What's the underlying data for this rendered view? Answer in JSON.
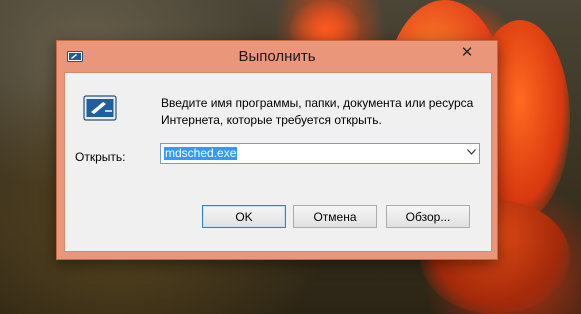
{
  "window": {
    "title": "Выполнить",
    "close_symbol": "✕"
  },
  "content": {
    "description": "Введите имя программы, папки, документа или ресурса Интернета, которые требуется открыть.",
    "open_label": "Открыть:",
    "open_value": "mdsched.exe",
    "dropdown_arrow": "⌄"
  },
  "buttons": {
    "ok": "OK",
    "cancel": "Отмена",
    "browse": "Обзор..."
  },
  "icons": {
    "title_icon": "run-icon",
    "main_icon": "run-program-icon",
    "close_icon": "close-icon",
    "dropdown_icon": "chevron-down-icon"
  },
  "colors": {
    "frame": "#e9967a",
    "selection": "#3399ff",
    "ok_border": "#3c7fb1"
  }
}
